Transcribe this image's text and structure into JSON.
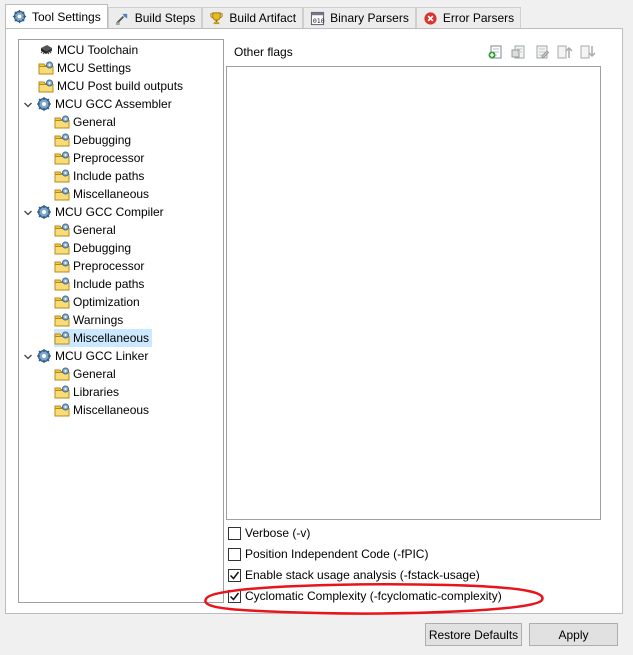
{
  "tabs": [
    {
      "label": "Tool Settings",
      "icon": "gear-icon",
      "active": true
    },
    {
      "label": "Build Steps",
      "icon": "build-steps-icon",
      "active": false
    },
    {
      "label": "Build Artifact",
      "icon": "trophy-icon",
      "active": false
    },
    {
      "label": "Binary Parsers",
      "icon": "binary-icon",
      "active": false
    },
    {
      "label": "Error Parsers",
      "icon": "error-icon",
      "active": false
    }
  ],
  "tree": [
    {
      "label": "MCU Toolchain",
      "icon": "chip-icon",
      "level": 0,
      "expander": false
    },
    {
      "label": "MCU Settings",
      "icon": "folder-settings-icon",
      "level": 0,
      "expander": false
    },
    {
      "label": "MCU Post build outputs",
      "icon": "folder-settings-icon",
      "level": 0,
      "expander": false
    },
    {
      "label": "MCU GCC Assembler",
      "icon": "gear-icon",
      "level": 0,
      "expander": true
    },
    {
      "label": "General",
      "icon": "folder-settings-icon",
      "level": 1
    },
    {
      "label": "Debugging",
      "icon": "folder-settings-icon",
      "level": 1
    },
    {
      "label": "Preprocessor",
      "icon": "folder-settings-icon",
      "level": 1
    },
    {
      "label": "Include paths",
      "icon": "folder-settings-icon",
      "level": 1
    },
    {
      "label": "Miscellaneous",
      "icon": "folder-settings-icon",
      "level": 1
    },
    {
      "label": "MCU GCC Compiler",
      "icon": "gear-icon",
      "level": 0,
      "expander": true
    },
    {
      "label": "General",
      "icon": "folder-settings-icon",
      "level": 1
    },
    {
      "label": "Debugging",
      "icon": "folder-settings-icon",
      "level": 1
    },
    {
      "label": "Preprocessor",
      "icon": "folder-settings-icon",
      "level": 1
    },
    {
      "label": "Include paths",
      "icon": "folder-settings-icon",
      "level": 1
    },
    {
      "label": "Optimization",
      "icon": "folder-settings-icon",
      "level": 1
    },
    {
      "label": "Warnings",
      "icon": "folder-settings-icon",
      "level": 1
    },
    {
      "label": "Miscellaneous",
      "icon": "folder-settings-icon",
      "level": 1,
      "selected": true
    },
    {
      "label": "MCU GCC Linker",
      "icon": "gear-icon",
      "level": 0,
      "expander": true
    },
    {
      "label": "General",
      "icon": "folder-settings-icon",
      "level": 1
    },
    {
      "label": "Libraries",
      "icon": "folder-settings-icon",
      "level": 1
    },
    {
      "label": "Miscellaneous",
      "icon": "folder-settings-icon",
      "level": 1
    }
  ],
  "flags": {
    "title": "Other flags",
    "tools": [
      "add-icon",
      "add-workspace-icon",
      "edit-icon",
      "move-up-icon",
      "move-down-icon"
    ]
  },
  "options": [
    {
      "label": "Verbose (-v)",
      "checked": false
    },
    {
      "label": "Position Independent Code (-fPIC)",
      "checked": false
    },
    {
      "label": "Enable stack usage analysis (-fstack-usage)",
      "checked": true
    },
    {
      "label": "Cyclomatic Complexity (-fcyclomatic-complexity)",
      "checked": true
    }
  ],
  "buttons": {
    "restore": "Restore Defaults",
    "apply": "Apply"
  },
  "colors": {
    "selection": "#cce8ff",
    "highlight_ellipse": "#e8141c"
  }
}
